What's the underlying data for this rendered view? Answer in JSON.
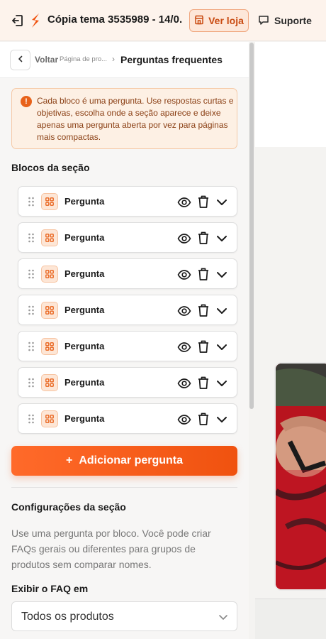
{
  "header": {
    "theme_title": "Cópia tema 3535989 - 14/0...",
    "view_store_label": "Ver loja",
    "support_label": "Suporte"
  },
  "breadcrumb": {
    "back_label": "Voltar",
    "parent": "Página de pro...",
    "separator": "›",
    "current": "Perguntas frequentes"
  },
  "info": {
    "icon": "!",
    "text": "Cada bloco é uma pergunta. Use respostas curtas e objetivas, escolha onde a seção aparece e deixe apenas uma pergunta aberta por vez para páginas mais compactas."
  },
  "blocks_section": {
    "title": "Blocos da seção",
    "items": [
      {
        "label": "Pergunta"
      },
      {
        "label": "Pergunta"
      },
      {
        "label": "Pergunta"
      },
      {
        "label": "Pergunta"
      },
      {
        "label": "Pergunta"
      },
      {
        "label": "Pergunta"
      },
      {
        "label": "Pergunta"
      }
    ],
    "add_label": "Adicionar pergunta",
    "add_icon": "+"
  },
  "settings": {
    "title": "Configurações da seção",
    "help": "Use uma pergunta por bloco. Você pode criar FAQs gerais ou diferentes para grupos de produtos sem comparar nomes.",
    "show_faq_label": "Exibir o FAQ em",
    "show_faq_value": "Todos os produtos"
  },
  "colors": {
    "accent": "#f0520f",
    "header_bg": "#fdf3ec"
  }
}
